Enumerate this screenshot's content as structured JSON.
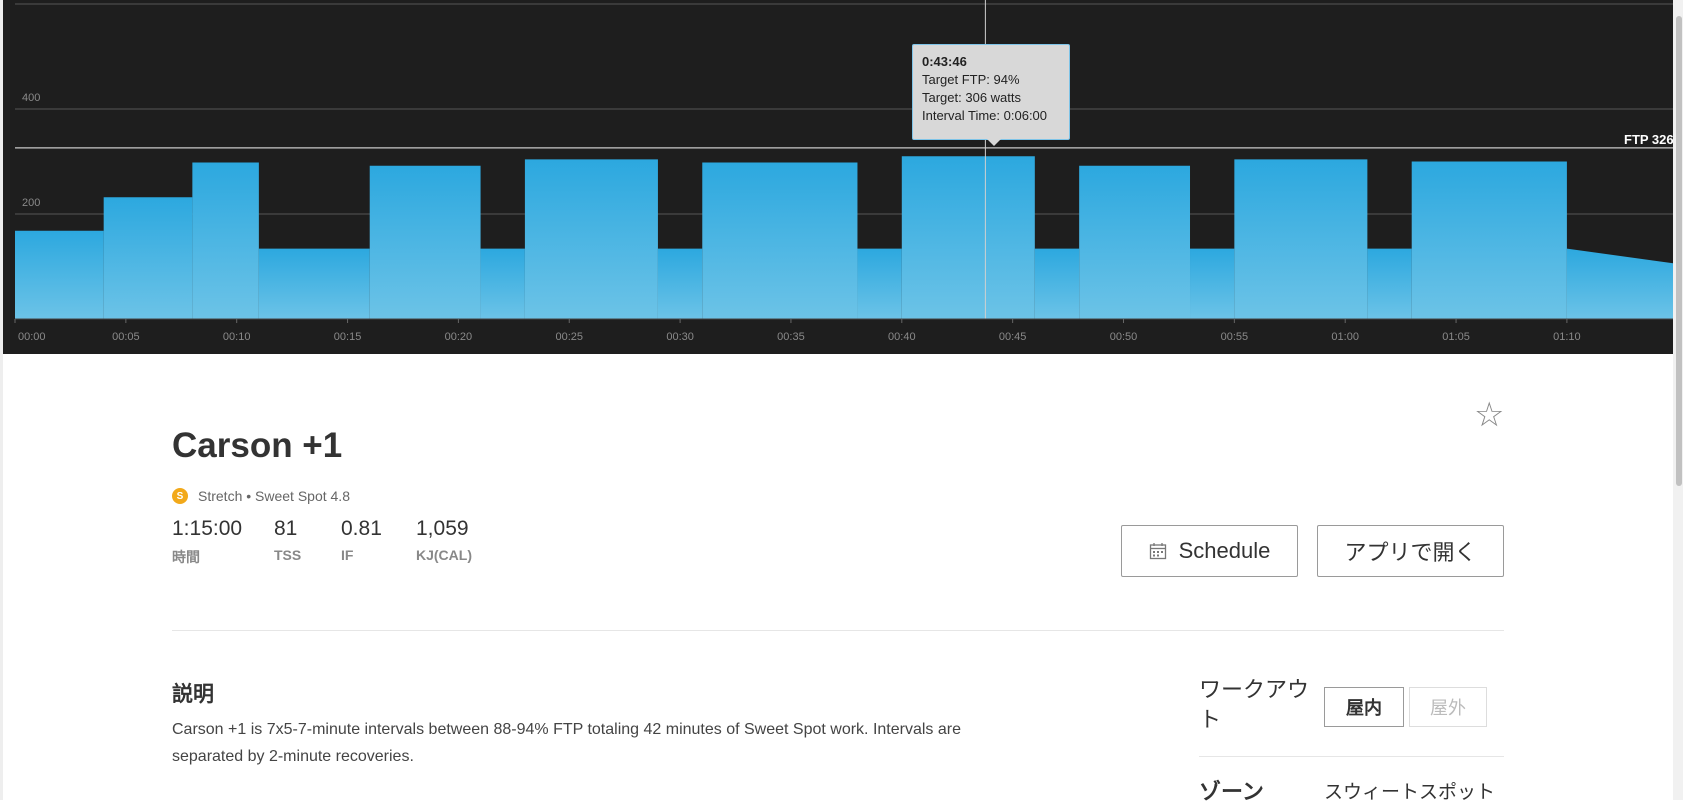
{
  "chart_data": {
    "type": "area",
    "x_tick_labels": [
      "00:00",
      "00:05",
      "00:10",
      "00:15",
      "00:20",
      "00:25",
      "00:30",
      "00:35",
      "00:40",
      "00:45",
      "00:50",
      "00:55",
      "01:00",
      "01:05",
      "01:10"
    ],
    "y_tick_labels": [
      "200",
      "400"
    ],
    "ylim": [
      0,
      600
    ],
    "x_unit": "minutes",
    "xlim": [
      0,
      75
    ],
    "segments": [
      {
        "start": 0,
        "end": 4,
        "watts": 168
      },
      {
        "start": 4,
        "end": 8,
        "watts": 232
      },
      {
        "start": 8,
        "end": 11,
        "watts": 298
      },
      {
        "start": 11,
        "end": 16,
        "watts": 134
      },
      {
        "start": 16,
        "end": 21,
        "watts": 292
      },
      {
        "start": 21,
        "end": 23,
        "watts": 134
      },
      {
        "start": 23,
        "end": 29,
        "watts": 304
      },
      {
        "start": 29,
        "end": 31,
        "watts": 134
      },
      {
        "start": 31,
        "end": 38,
        "watts": 298
      },
      {
        "start": 38,
        "end": 40,
        "watts": 134
      },
      {
        "start": 40,
        "end": 46,
        "watts": 310
      },
      {
        "start": 46,
        "end": 48,
        "watts": 134
      },
      {
        "start": 48,
        "end": 53,
        "watts": 292
      },
      {
        "start": 53,
        "end": 55,
        "watts": 134
      },
      {
        "start": 55,
        "end": 61,
        "watts": 304
      },
      {
        "start": 61,
        "end": 63,
        "watts": 134
      },
      {
        "start": 63,
        "end": 70,
        "watts": 300
      },
      {
        "start": 70,
        "end": 75,
        "watts_start": 134,
        "watts_end": 105
      }
    ],
    "ftp_watts": 326,
    "ftp_label": "FTP 326",
    "cursor_minutes": 43.77,
    "colors": {
      "fill_top": "#2ca8df",
      "fill_bottom": "#6cc3e7",
      "background": "#1e1e1e",
      "grid": "#555555",
      "ftp_line": "#c8c8c8"
    }
  },
  "tooltip": {
    "time": "0:43:46",
    "target_ftp": "Target FTP: 94%",
    "target_watts": "Target: 306 watts",
    "interval_time": "Interval Time: 0:06:00"
  },
  "workout": {
    "title": "Carson +1",
    "badge_letter": "S",
    "subtitle": "Stretch • Sweet Spot 4.8",
    "stats": [
      {
        "value": "1:15:00",
        "label": "時間"
      },
      {
        "value": "81",
        "label": "TSS"
      },
      {
        "value": "0.81",
        "label": "IF"
      },
      {
        "value": "1,059",
        "label": "KJ(CAL)"
      }
    ],
    "favorite_icon": "star-outline-icon"
  },
  "buttons": {
    "schedule": "Schedule",
    "open_in_app": "アプリで開く"
  },
  "description": {
    "heading": "説明",
    "text": "Carson +1 is 7x5-7-minute intervals between 88-94% FTP totaling 42 minutes of Sweet Spot work. Intervals are separated by 2-minute recoveries."
  },
  "details": {
    "workout_label": "ワークアウト",
    "indoor": "屋内",
    "outdoor": "屋外",
    "zone_label": "ゾーン",
    "zone_value": "スウィートスポット"
  }
}
